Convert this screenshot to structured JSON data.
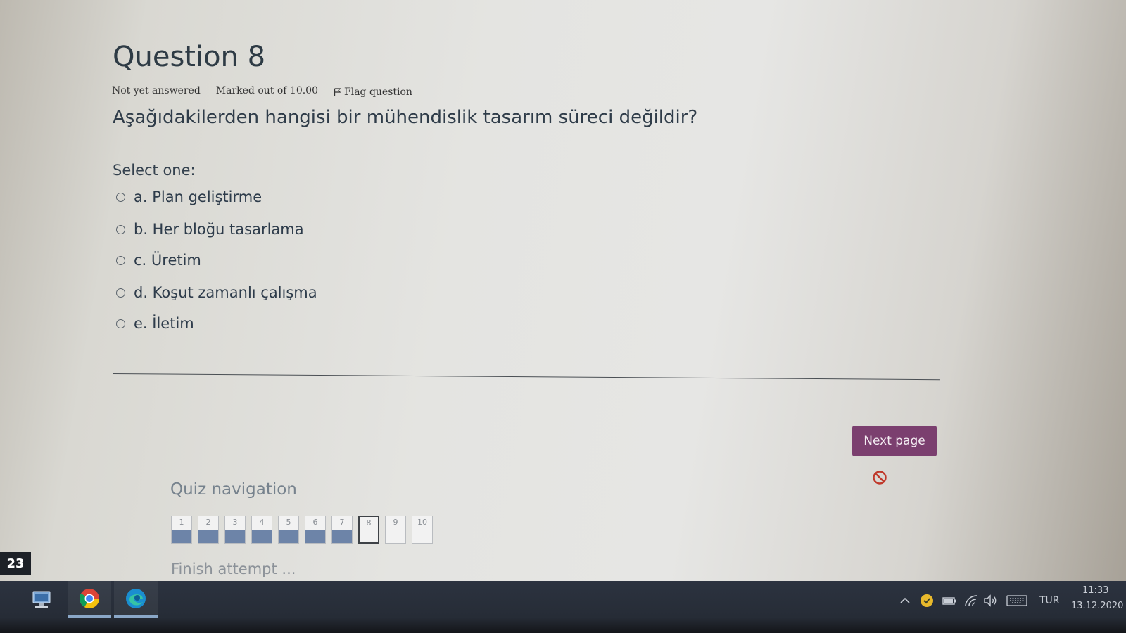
{
  "question": {
    "title": "Question 8",
    "status": "Not yet answered",
    "marked_out_of": "Marked out of 10.00",
    "flag_label": "Flag question",
    "text": "Aşağıdakilerden hangisi bir mühendislik tasarım süreci değildir?",
    "select_label": "Select one:",
    "answers": [
      {
        "label": "a. Plan geliştirme",
        "selected": false
      },
      {
        "label": "b. Her bloğu tasarlama",
        "selected": false
      },
      {
        "label": "c. Üretim",
        "selected": false
      },
      {
        "label": "d. Koşut zamanlı çalışma",
        "selected": false
      },
      {
        "label": "e. İletim",
        "selected": false
      }
    ]
  },
  "actions": {
    "next_page": "Next page"
  },
  "quiz_navigation": {
    "title": "Quiz navigation",
    "buttons": [
      {
        "number": "1",
        "state": "answered"
      },
      {
        "number": "2",
        "state": "answered"
      },
      {
        "number": "3",
        "state": "answered"
      },
      {
        "number": "4",
        "state": "answered"
      },
      {
        "number": "5",
        "state": "answered"
      },
      {
        "number": "6",
        "state": "answered"
      },
      {
        "number": "7",
        "state": "answered"
      },
      {
        "number": "8",
        "state": "current"
      },
      {
        "number": "9",
        "state": "unanswered"
      },
      {
        "number": "10",
        "state": "unanswered"
      }
    ],
    "finish_attempt": "Finish attempt ..."
  },
  "side_badge": "23",
  "taskbar": {
    "apps": [
      "network-computer-icon",
      "chrome-icon",
      "edge-icon"
    ],
    "tray_icons": [
      "chevron-up-icon",
      "norton-icon",
      "battery-icon",
      "wifi-icon",
      "volume-icon",
      "keyboard-icon"
    ],
    "language": "TUR",
    "time": "11:33",
    "date": "13.12.2020"
  },
  "colors": {
    "accent_button": "#7b3f6f",
    "answered_fill": "#6d84a8",
    "taskbar": "#262c36"
  }
}
